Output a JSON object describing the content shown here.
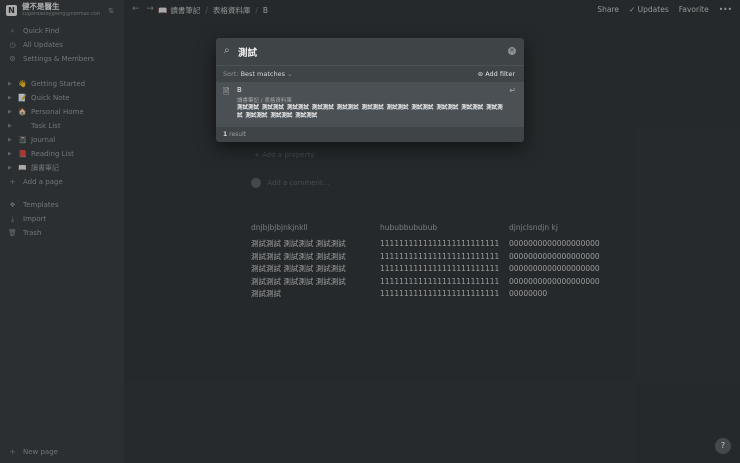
{
  "sidebar": {
    "workspace": {
      "avatar": "N",
      "title": "健不是醫生",
      "subtitle": "sugarbaddyjpeng@hotmail.com"
    },
    "top_items": [
      {
        "icon": "search-icon",
        "label": "Quick Find"
      },
      {
        "icon": "clock-icon",
        "label": "All Updates"
      },
      {
        "icon": "gear-icon",
        "label": "Settings & Members"
      }
    ],
    "pages": [
      {
        "emoji": "👋",
        "label": "Getting Started"
      },
      {
        "emoji": "📝",
        "label": "Quick Note"
      },
      {
        "emoji": "🏠",
        "label": "Personal Home"
      },
      {
        "emoji": "",
        "label": "Task List"
      },
      {
        "emoji": "📓",
        "label": "Journal"
      },
      {
        "emoji": "📕",
        "label": "Reading List"
      },
      {
        "emoji": "📖",
        "label": "讀書筆記"
      }
    ],
    "add_page": "Add a page",
    "bottom_items": [
      {
        "icon": "templates-icon",
        "label": "Templates"
      },
      {
        "icon": "import-icon",
        "label": "Import"
      },
      {
        "icon": "trash-icon",
        "label": "Trash"
      }
    ],
    "new_page": "New page"
  },
  "topbar": {
    "breadcrumbs": [
      "讀書筆記",
      "表格資料庫",
      "B"
    ],
    "share": "Share",
    "updates": "Updates",
    "favorite": "Favorite",
    "more": "•••"
  },
  "page": {
    "add_property": "Add a property",
    "add_comment": "Add a comment...",
    "table": {
      "headers": [
        "dnjbjbjbjnkjnkll",
        "hububbububub",
        "djnjclsndjn kj"
      ],
      "rows": [
        [
          "測試測試 測試測試 測試測試",
          "1111111111111111111111111",
          "0000000000000000000"
        ],
        [
          "測試測試 測試測試 測試測試",
          "1111111111111111111111111",
          "0000000000000000000"
        ],
        [
          "測試測試 測試測試 測試測試",
          "1111111111111111111111111",
          "0000000000000000000"
        ],
        [
          "測試測試 測試測試 測試測試",
          "1111111111111111111111111",
          "0000000000000000000"
        ],
        [
          "測試測試",
          "1111111111111111111111111",
          "00000000"
        ]
      ]
    }
  },
  "search": {
    "query": "測試",
    "sort_label": "Sort:",
    "sort_value": "Best matches",
    "add_filter": "Add filter",
    "result": {
      "title": "B",
      "path": "讀書筆記 / 表格資料庫",
      "snippet": "測試測試 測試測試 測試測試 測試測試 測試測試 測試測試 測試測試 測試測試 測試測試 測試測試 測試測試 測試測試 測試測試 測試測試"
    },
    "count": "1",
    "count_label": "result"
  },
  "help": "?"
}
